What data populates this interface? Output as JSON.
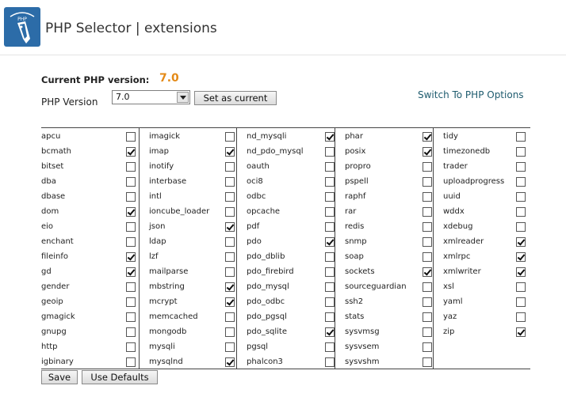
{
  "header": {
    "title": "PHP Selector | extensions",
    "logo_icon": "php-elephant-logo",
    "logo_text": "PHP"
  },
  "current": {
    "label": "Current PHP version:",
    "value": "7.0"
  },
  "version_select": {
    "label": "PHP Version",
    "selected": "7.0"
  },
  "buttons": {
    "set_current": "Set as current",
    "save": "Save",
    "use_defaults": "Use Defaults"
  },
  "switch_link": "Switch To PHP Options",
  "columns": [
    [
      {
        "name": "apcu",
        "checked": false
      },
      {
        "name": "bcmath",
        "checked": true
      },
      {
        "name": "bitset",
        "checked": false
      },
      {
        "name": "dba",
        "checked": false
      },
      {
        "name": "dbase",
        "checked": false
      },
      {
        "name": "dom",
        "checked": true
      },
      {
        "name": "eio",
        "checked": false
      },
      {
        "name": "enchant",
        "checked": false
      },
      {
        "name": "fileinfo",
        "checked": true
      },
      {
        "name": "gd",
        "checked": true
      },
      {
        "name": "gender",
        "checked": false
      },
      {
        "name": "geoip",
        "checked": false
      },
      {
        "name": "gmagick",
        "checked": false
      },
      {
        "name": "gnupg",
        "checked": false
      },
      {
        "name": "http",
        "checked": false
      },
      {
        "name": "igbinary",
        "checked": false
      }
    ],
    [
      {
        "name": "imagick",
        "checked": false
      },
      {
        "name": "imap",
        "checked": true
      },
      {
        "name": "inotify",
        "checked": false
      },
      {
        "name": "interbase",
        "checked": false
      },
      {
        "name": "intl",
        "checked": false
      },
      {
        "name": "ioncube_loader",
        "checked": false
      },
      {
        "name": "json",
        "checked": true
      },
      {
        "name": "ldap",
        "checked": false
      },
      {
        "name": "lzf",
        "checked": false
      },
      {
        "name": "mailparse",
        "checked": false
      },
      {
        "name": "mbstring",
        "checked": true
      },
      {
        "name": "mcrypt",
        "checked": true
      },
      {
        "name": "memcached",
        "checked": false
      },
      {
        "name": "mongodb",
        "checked": false
      },
      {
        "name": "mysqli",
        "checked": false
      },
      {
        "name": "mysqlnd",
        "checked": true
      }
    ],
    [
      {
        "name": "nd_mysqli",
        "checked": true
      },
      {
        "name": "nd_pdo_mysql",
        "checked": false
      },
      {
        "name": "oauth",
        "checked": false
      },
      {
        "name": "oci8",
        "checked": false
      },
      {
        "name": "odbc",
        "checked": false
      },
      {
        "name": "opcache",
        "checked": false
      },
      {
        "name": "pdf",
        "checked": false
      },
      {
        "name": "pdo",
        "checked": true
      },
      {
        "name": "pdo_dblib",
        "checked": false
      },
      {
        "name": "pdo_firebird",
        "checked": false
      },
      {
        "name": "pdo_mysql",
        "checked": false
      },
      {
        "name": "pdo_odbc",
        "checked": false
      },
      {
        "name": "pdo_pgsql",
        "checked": false
      },
      {
        "name": "pdo_sqlite",
        "checked": true
      },
      {
        "name": "pgsql",
        "checked": false
      },
      {
        "name": "phalcon3",
        "checked": false
      }
    ],
    [
      {
        "name": "phar",
        "checked": true
      },
      {
        "name": "posix",
        "checked": true
      },
      {
        "name": "propro",
        "checked": false
      },
      {
        "name": "pspell",
        "checked": false
      },
      {
        "name": "raphf",
        "checked": false
      },
      {
        "name": "rar",
        "checked": false
      },
      {
        "name": "redis",
        "checked": false
      },
      {
        "name": "snmp",
        "checked": false
      },
      {
        "name": "soap",
        "checked": false
      },
      {
        "name": "sockets",
        "checked": true
      },
      {
        "name": "sourceguardian",
        "checked": false
      },
      {
        "name": "ssh2",
        "checked": false
      },
      {
        "name": "stats",
        "checked": false
      },
      {
        "name": "sysvmsg",
        "checked": false
      },
      {
        "name": "sysvsem",
        "checked": false
      },
      {
        "name": "sysvshm",
        "checked": false
      }
    ],
    [
      {
        "name": "tidy",
        "checked": false
      },
      {
        "name": "timezonedb",
        "checked": false
      },
      {
        "name": "trader",
        "checked": false
      },
      {
        "name": "uploadprogress",
        "checked": false
      },
      {
        "name": "uuid",
        "checked": false
      },
      {
        "name": "wddx",
        "checked": false
      },
      {
        "name": "xdebug",
        "checked": false
      },
      {
        "name": "xmlreader",
        "checked": true
      },
      {
        "name": "xmlrpc",
        "checked": true
      },
      {
        "name": "xmlwriter",
        "checked": true
      },
      {
        "name": "xsl",
        "checked": false
      },
      {
        "name": "yaml",
        "checked": false
      },
      {
        "name": "yaz",
        "checked": false
      },
      {
        "name": "zip",
        "checked": true
      }
    ]
  ],
  "colors": {
    "accent_version": "#e48a17",
    "link": "#1e5b6e",
    "logo_bg": "#2c6ca8"
  }
}
